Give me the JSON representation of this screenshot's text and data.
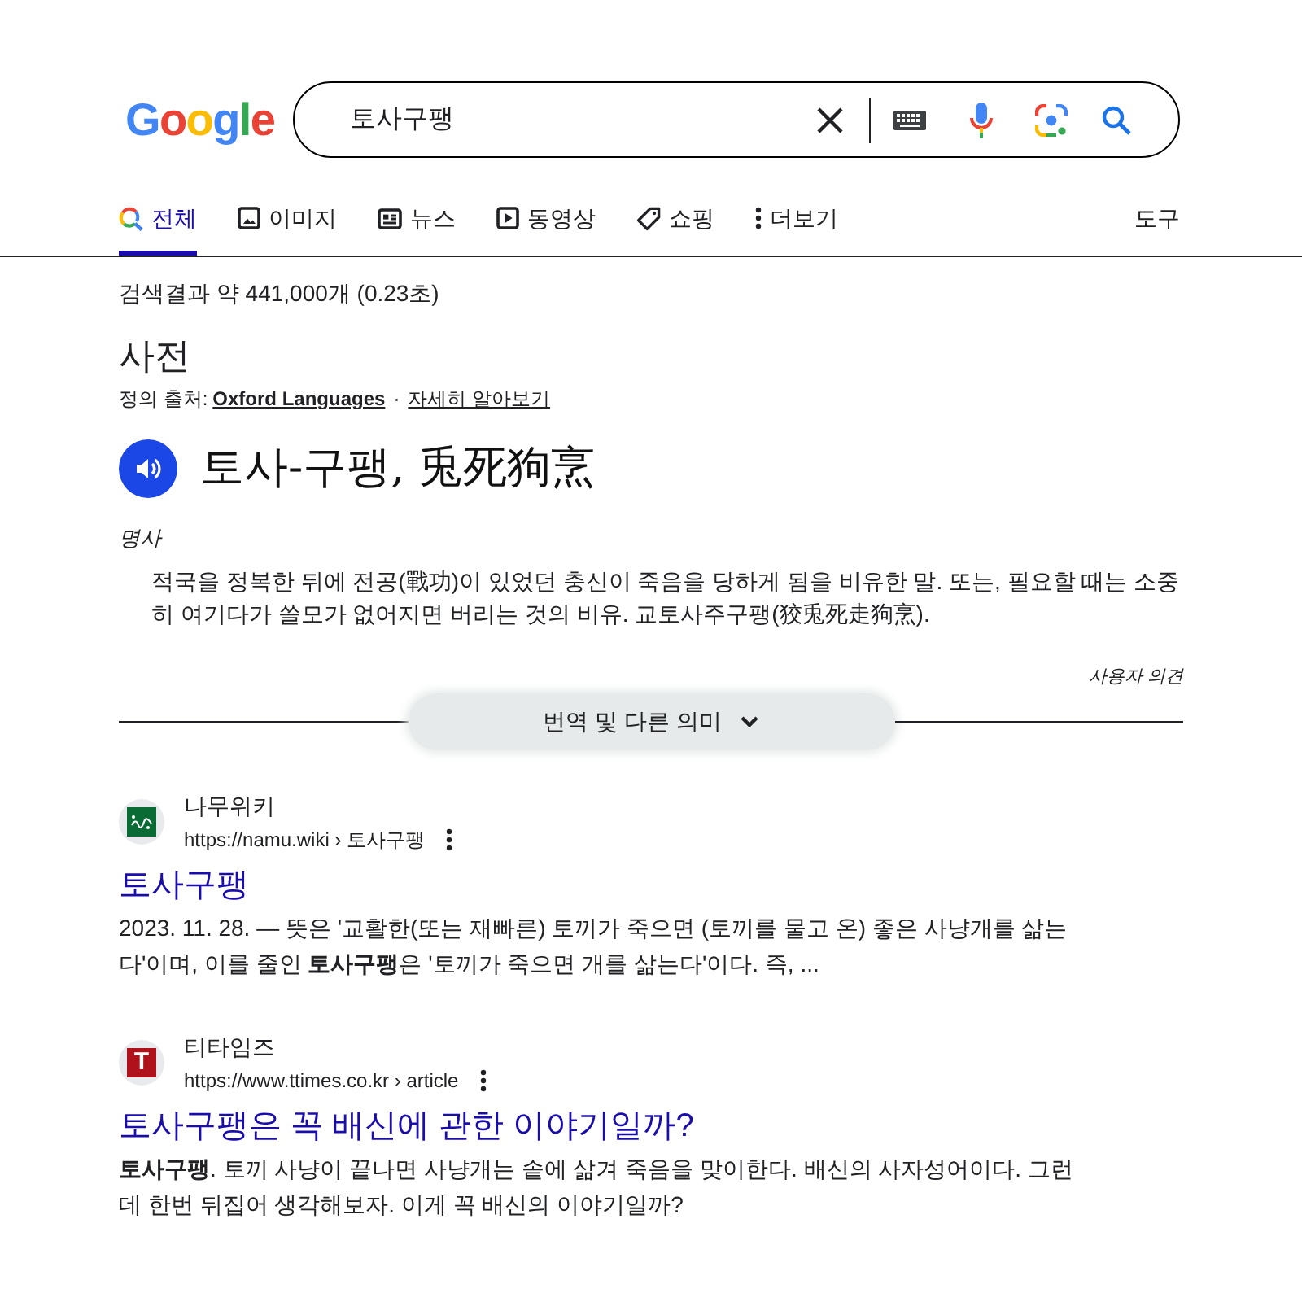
{
  "header": {
    "logo": "Google",
    "search": {
      "value": "토사구팽"
    }
  },
  "tabs": [
    {
      "label": "전체",
      "kind": "all",
      "selected": true
    },
    {
      "label": "이미지",
      "kind": "images",
      "selected": false
    },
    {
      "label": "뉴스",
      "kind": "news",
      "selected": false
    },
    {
      "label": "동영상",
      "kind": "videos",
      "selected": false
    },
    {
      "label": "쇼핑",
      "kind": "shopping",
      "selected": false
    },
    {
      "label": "더보기",
      "kind": "more",
      "selected": false
    }
  ],
  "tools": "도구",
  "result_stats": "검색결과 약 441,000개 (0.23초)",
  "dictionary": {
    "title": "사전",
    "source_label": "정의 출처:",
    "source_link": "Oxford Languages",
    "separator": "·",
    "learn_more": "자세히 알아보기",
    "headword": "토사-구팽, 兎死狗烹",
    "part_of_speech": "명사",
    "definition": "적국을 정복한 뒤에 전공(戰功)이 있었던 충신이 죽음을 당하게 됨을 비유한 말. 또는, 필요할 때는 소중히 여기다가 쓸모가 없어지면 버리는 것의 비유. 교토사주구팽(狡兎死走狗烹).",
    "feedback": "사용자 의견",
    "more_button": "번역 및 다른 의미"
  },
  "results": [
    {
      "favicon": {
        "kind": "tree"
      },
      "site": "나무위키",
      "url": "https://namu.wiki › 토사구팽",
      "title": "토사구팽",
      "snippet": "2023. 11. 28. — 뜻은 '교활한(또는 재빠른) 토끼가 죽으면 (토끼를 물고 온) 좋은 사냥개를 삶는다'이며, 이를 줄인 **토사구팽**은 '토끼가 죽으면 개를 삶는다'이다. 즉, ..."
    },
    {
      "favicon": {
        "kind": "letter",
        "text": "T"
      },
      "site": "티타임즈",
      "url": "https://www.ttimes.co.kr › article",
      "title": "토사구팽은 꼭 배신에 관한 이야기일까?",
      "snippet": "**토사구팽**. 토끼 사냥이 끝나면 사냥개는 솥에 삶겨 죽음을 맞이한다. 배신의 사자성어이다. 그런데 한번 뒤집어 생각해보자. 이게 꼭 배신의 이야기일까?"
    }
  ]
}
